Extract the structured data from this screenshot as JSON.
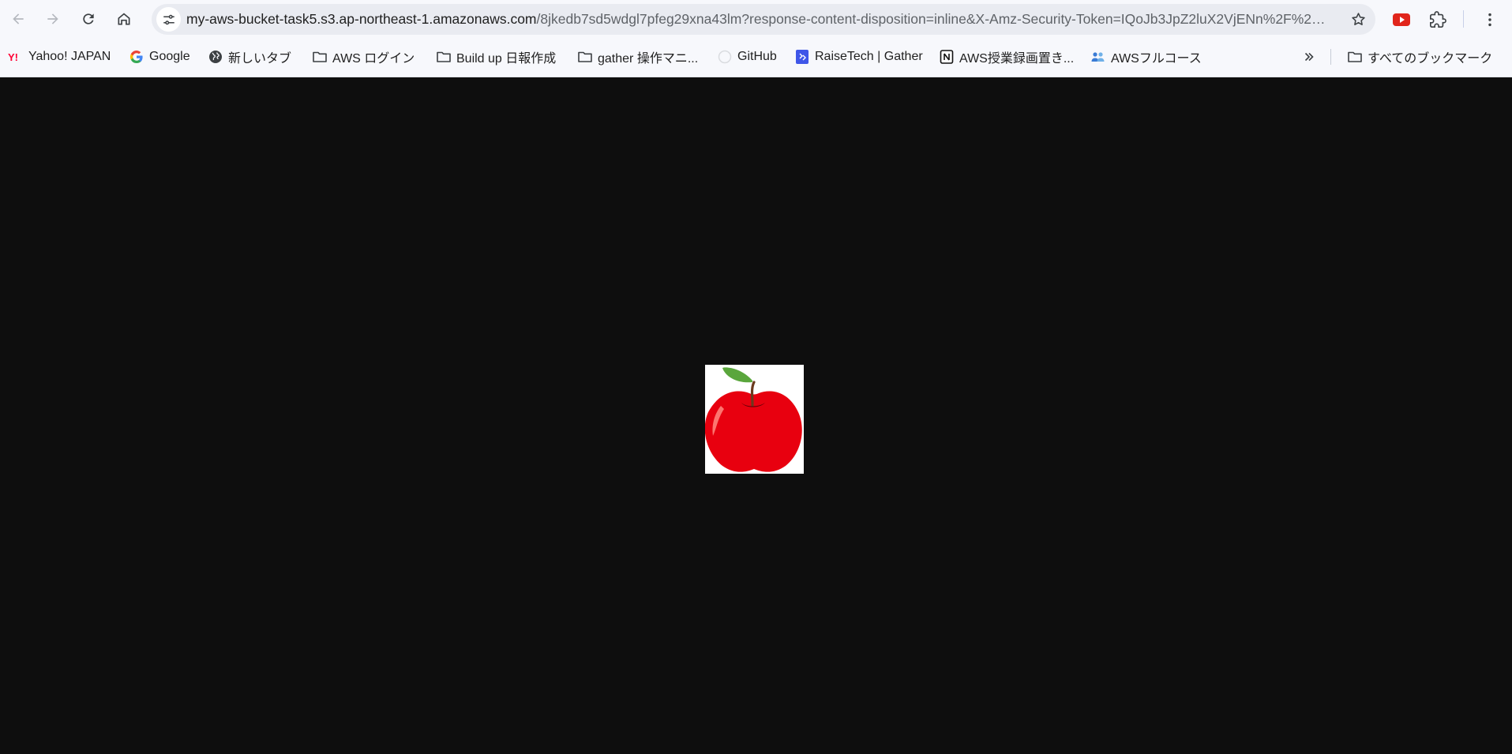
{
  "toolbar": {
    "back_label": "Back",
    "forward_label": "Forward",
    "reload_label": "Reload",
    "home_label": "Home"
  },
  "omnibox": {
    "url_host": "my-aws-bucket-task5.s3.ap-northeast-1.amazonaws.com",
    "url_path": "/8jkedb7sd5wdgl7pfeg29xna43lm?response-content-disposition=inline&X-Amz-Security-Token=IQoJb3JpZ2luX2VjENn%2F%2F%..."
  },
  "bookmarks": {
    "items": [
      {
        "label": "Yahoo! JAPAN",
        "icon": "yahoo-icon"
      },
      {
        "label": "Google",
        "icon": "google-icon"
      },
      {
        "label": "新しいタブ",
        "icon": "globe-icon"
      },
      {
        "label": "AWS ログイン",
        "icon": "folder-icon"
      },
      {
        "label": "Build up 日報作成",
        "icon": "folder-icon"
      },
      {
        "label": "gather 操作マニ...",
        "icon": "folder-icon"
      },
      {
        "label": "GitHub",
        "icon": "github-icon"
      },
      {
        "label": "RaiseTech | Gather",
        "icon": "gather-icon"
      },
      {
        "label": "AWS授業録画置き...",
        "icon": "notion-icon"
      },
      {
        "label": "AWSフルコース",
        "icon": "people-icon"
      }
    ],
    "all_bookmarks_label": "すべてのブックマーク"
  },
  "colors": {
    "chrome_bg": "#f7f8fc",
    "omnibox_bg": "#e9ebf1",
    "viewer_bg": "#0e0e0e",
    "apple_red": "#e8000f",
    "leaf_green": "#5aa63c"
  }
}
